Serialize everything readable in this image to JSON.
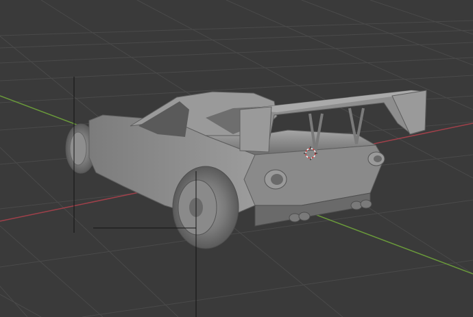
{
  "viewport": {
    "background": "#3a3a3a",
    "grid_color": "#4a4a4a",
    "x_axis_color": "#a0404a",
    "y_axis_color": "#6a9a3a"
  },
  "scene": {
    "object": "race-car-mesh",
    "shading": "solid",
    "mesh_color": "#8a8a8a"
  },
  "icons": {
    "cursor": "3d-cursor-icon"
  }
}
